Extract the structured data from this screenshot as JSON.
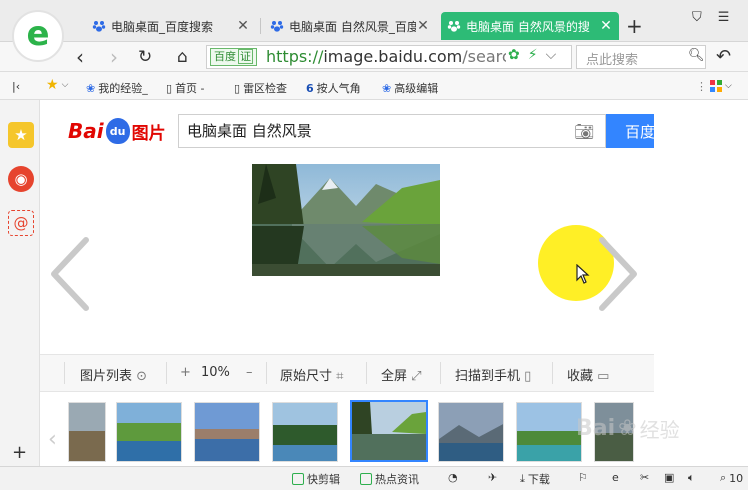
{
  "tabs": [
    {
      "label": "电脑桌面_百度搜索",
      "active": false
    },
    {
      "label": "电脑桌面 自然风景_百度",
      "active": false
    },
    {
      "label": "电脑桌面 自然风景的搜",
      "active": true
    }
  ],
  "address": {
    "badge": "百度",
    "badge_mark": "证",
    "url_prefix": "https://",
    "url_host": "image.baidu.com",
    "url_rest": "/searc",
    "search_placeholder": "点此搜索"
  },
  "bookmarks": [
    {
      "label": "我的经验_",
      "icon": "paw-icon"
    },
    {
      "label": "首页 -",
      "icon": "page-icon"
    },
    {
      "label": "雷区检查",
      "icon": "page-icon"
    },
    {
      "label": "按人气角",
      "icon": "six-icon"
    },
    {
      "label": "高级编辑",
      "icon": "paw-icon"
    }
  ],
  "search": {
    "query": "电脑桌面 自然风景",
    "button": "百度一下",
    "logo_text": "Bai",
    "logo_du": "du",
    "logo_suffix": "图片"
  },
  "toolbar": {
    "list": "图片列表",
    "zoom_plus": "+",
    "zoom": "10%",
    "zoom_minus": "–",
    "original": "原始尺寸",
    "fullscreen": "全屏",
    "scan": "扫描到手机",
    "favorite": "收藏"
  },
  "statusbar": {
    "quick_edit": "快剪辑",
    "hot_news": "热点资讯",
    "download": "下载",
    "zoom": "10"
  },
  "watermark": {
    "text": "Bai",
    "suffix": "经验"
  },
  "colors": {
    "accent": "#2dbb76",
    "baidu_blue": "#3385ff",
    "baidu_red": "#e10602"
  }
}
